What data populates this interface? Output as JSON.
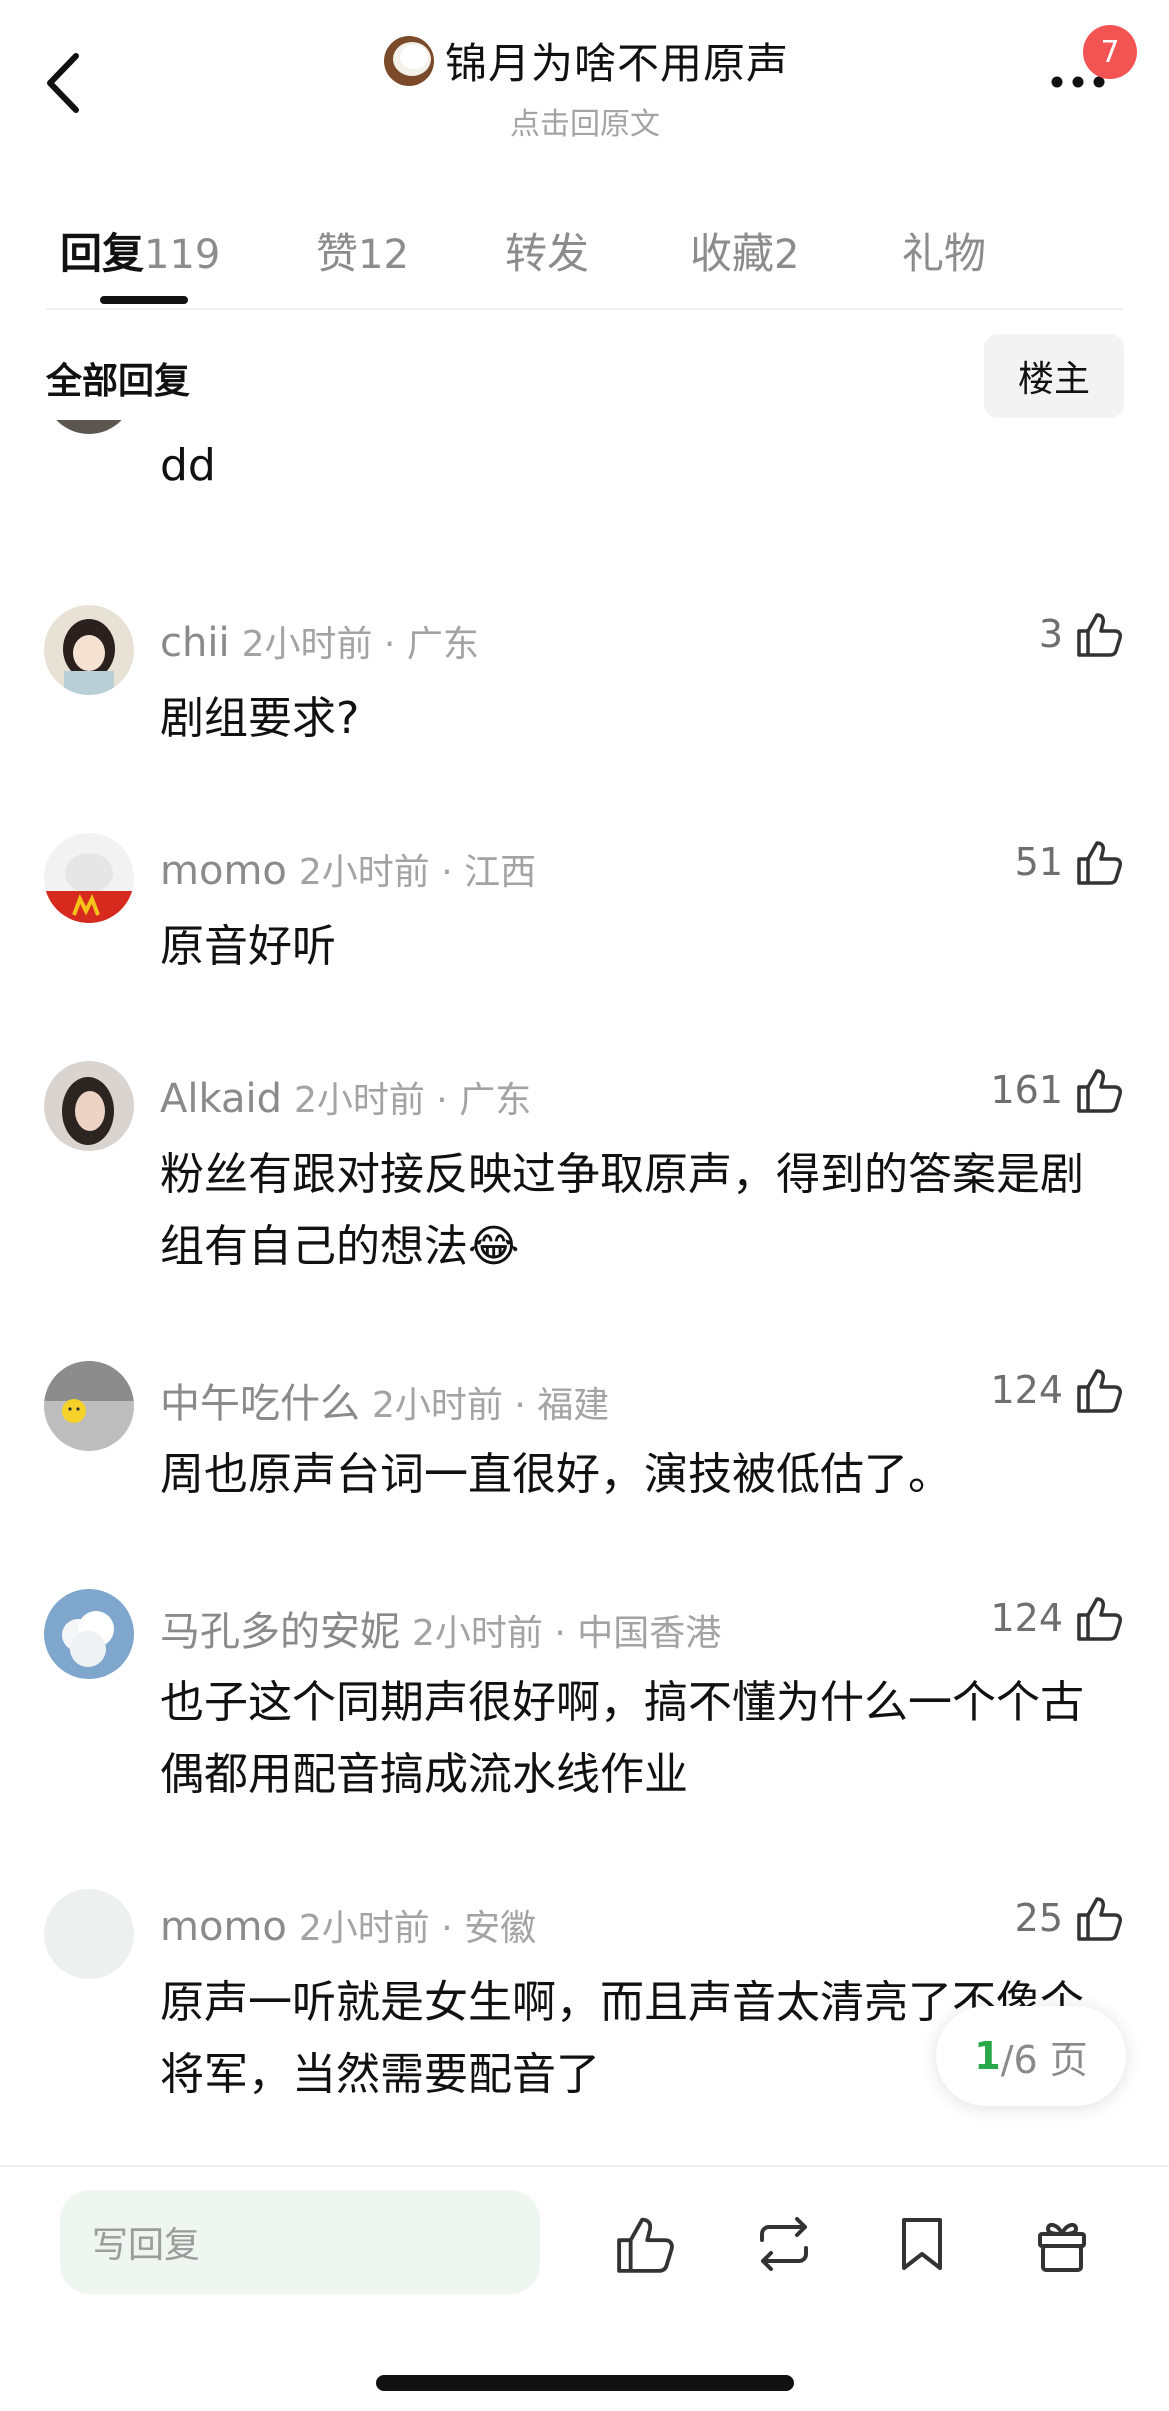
{
  "header": {
    "title": "锦月为啥不用原声",
    "subtitle": "点击回原文",
    "notification_count": "7"
  },
  "tabs": [
    {
      "label": "回复",
      "count": "119",
      "active": true
    },
    {
      "label": "赞",
      "count": "12",
      "active": false
    },
    {
      "label": "转发",
      "count": "",
      "active": false
    },
    {
      "label": "收藏",
      "count": "2",
      "active": false
    },
    {
      "label": "礼物",
      "count": "",
      "active": false
    }
  ],
  "filter": {
    "label": "全部回复",
    "owner_button": "楼主"
  },
  "comments": [
    {
      "name": "",
      "time": "",
      "likes": "",
      "text": "dd",
      "avatar": "cut-off"
    },
    {
      "name": "chii",
      "time": "2小时前 · 广东",
      "likes": "3",
      "text": "剧组要求?"
    },
    {
      "name": "momo",
      "time": "2小时前 · 江西",
      "likes": "51",
      "text": "原音好听"
    },
    {
      "name": "Alkaid",
      "time": "2小时前 · 广东",
      "likes": "161",
      "text": "粉丝有跟对接反映过争取原声，得到的答案是剧组有自己的想法😂"
    },
    {
      "name": "中午吃什么",
      "time": "2小时前 · 福建",
      "likes": "124",
      "text": "周也原声台词一直很好，演技被低估了。"
    },
    {
      "name": "马孔多的安妮",
      "time": "2小时前 · 中国香港",
      "likes": "124",
      "text": "也子这个同期声很好啊，搞不懂为什么一个个古偶都用配音搞成流水线作业"
    },
    {
      "name": "momo",
      "time": "2小时前 · 安徽",
      "likes": "25",
      "text": "原声一听就是女生啊，而且声音太清亮了不像个将军，当然需要配音了"
    }
  ],
  "pager": {
    "current": "1",
    "total": "/6 页"
  },
  "bottom_bar": {
    "reply_placeholder": "写回复",
    "icons": [
      "like-icon",
      "repost-icon",
      "bookmark-icon",
      "gift-icon"
    ]
  },
  "colors": {
    "badge": "#f25454",
    "pager_current": "#2aa84a",
    "input_bg": "#eef6ef"
  }
}
